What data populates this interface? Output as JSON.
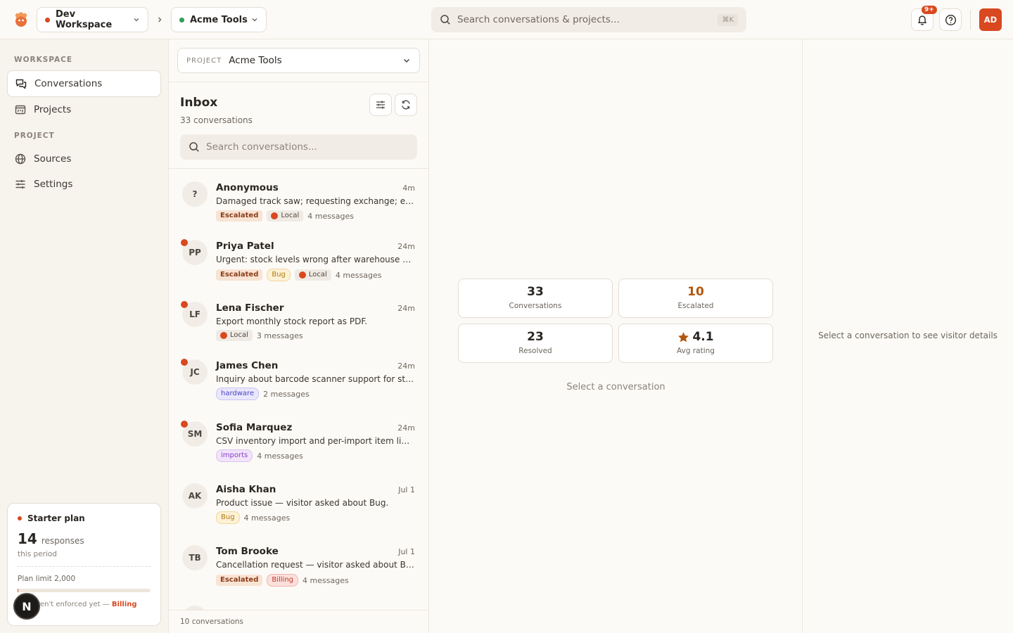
{
  "topbar": {
    "workspace": "Dev Workspace",
    "project": "Acme Tools",
    "search_placeholder": "Search conversations & projects...",
    "search_shortcut": "⌘K",
    "notifications_badge": "9+",
    "user_initials": "AD"
  },
  "sidebar": {
    "workspace_label": "WORKSPACE",
    "project_label": "PROJECT",
    "workspace_items": [
      {
        "label": "Conversations",
        "icon": "chat-icon",
        "active": true
      },
      {
        "label": "Projects",
        "icon": "projects-icon",
        "active": false
      }
    ],
    "project_items": [
      {
        "label": "Sources",
        "icon": "globe-icon"
      },
      {
        "label": "Settings",
        "icon": "sliders-icon"
      }
    ],
    "plan": {
      "title": "Starter plan",
      "count": "14",
      "count_label": "responses",
      "period": "this period",
      "limit": "Plan limit 2,000",
      "usage_fraction": 0.007,
      "note": "aren't enforced yet —",
      "note_link": "Billing"
    },
    "floating_button": "N"
  },
  "list": {
    "project_label": "PROJECT",
    "project_value": "Acme Tools",
    "title": "Inbox",
    "subtitle": "33 conversations",
    "search_placeholder": "Search conversations...",
    "footer": "10 conversations",
    "conversations": [
      {
        "initials": "?",
        "unread": false,
        "name": "Anonymous",
        "time": "4m",
        "snippet": "Damaged track saw; requesting exchange; escalated to support",
        "tags": [
          "Escalated",
          "Local"
        ],
        "messages": "4 messages"
      },
      {
        "initials": "PP",
        "unread": true,
        "name": "Priya Patel",
        "time": "24m",
        "snippet": "Urgent: stock levels wrong after warehouse sync again",
        "tags": [
          "Escalated",
          "Bug",
          "Local"
        ],
        "messages": "4 messages"
      },
      {
        "initials": "LF",
        "unread": true,
        "name": "Lena Fischer",
        "time": "24m",
        "snippet": "Export monthly stock report as PDF.",
        "tags": [
          "Local"
        ],
        "messages": "3 messages"
      },
      {
        "initials": "JC",
        "unread": true,
        "name": "James Chen",
        "time": "24m",
        "snippet": "Inquiry about barcode scanner support for stocktakes",
        "tags": [
          "hardware"
        ],
        "messages": "2 messages"
      },
      {
        "initials": "SM",
        "unread": true,
        "name": "Sofia Marquez",
        "time": "24m",
        "snippet": "CSV inventory import and per-import item limits",
        "tags": [
          "imports"
        ],
        "messages": "4 messages"
      },
      {
        "initials": "AK",
        "unread": false,
        "name": "Aisha Khan",
        "time": "Jul 1",
        "snippet": "Product issue — visitor asked about Bug.",
        "tags": [
          "Bug"
        ],
        "messages": "4 messages"
      },
      {
        "initials": "TB",
        "unread": false,
        "name": "Tom Brooke",
        "time": "Jul 1",
        "snippet": "Cancellation request — visitor asked about Billing.",
        "tags": [
          "Escalated",
          "Billing"
        ],
        "messages": "4 messages"
      }
    ]
  },
  "stats": [
    {
      "value": "33",
      "label": "Conversations",
      "color": "#2a2622"
    },
    {
      "value": "10",
      "label": "Escalated",
      "color": "#b4560f"
    },
    {
      "value": "23",
      "label": "Resolved",
      "color": "#2a2622"
    },
    {
      "value": "4.1",
      "label": "Avg rating",
      "color": "#2a2622",
      "icon": "star-icon"
    }
  ],
  "main": {
    "empty_message": "Select a conversation"
  },
  "details": {
    "empty_message": "Select a conversation to see visitor details"
  },
  "colors": {
    "accent": "#d9481f",
    "workspace_dot": "#d9481f",
    "project_dot": "#2e9e5b",
    "star": "#b4560f"
  }
}
